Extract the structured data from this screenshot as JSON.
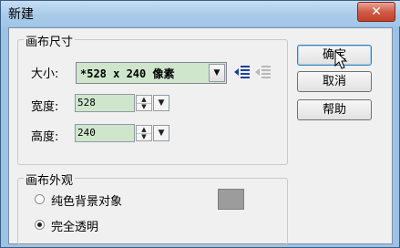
{
  "window": {
    "title": "新建",
    "close": "✕"
  },
  "canvas_size": {
    "group_label": "画布尺寸",
    "size_label": "大小:",
    "size_value": "*528 x 240 像素",
    "width_label": "宽度:",
    "width_value": "528",
    "height_label": "高度:",
    "height_value": "240"
  },
  "canvas_appearance": {
    "group_label": "画布外观",
    "options": [
      {
        "label": "纯色背景对象",
        "selected": false
      },
      {
        "label": "完全透明",
        "selected": true
      }
    ],
    "swatch_color": "#9c9c9c"
  },
  "buttons": {
    "ok": "确定",
    "cancel": "取消",
    "help": "帮助"
  },
  "icons": {
    "add_size": "add-preset-icon",
    "remove_size": "remove-preset-icon",
    "spin": "spin-arrows-icon",
    "dropdown": "dropdown-arrow-icon"
  }
}
